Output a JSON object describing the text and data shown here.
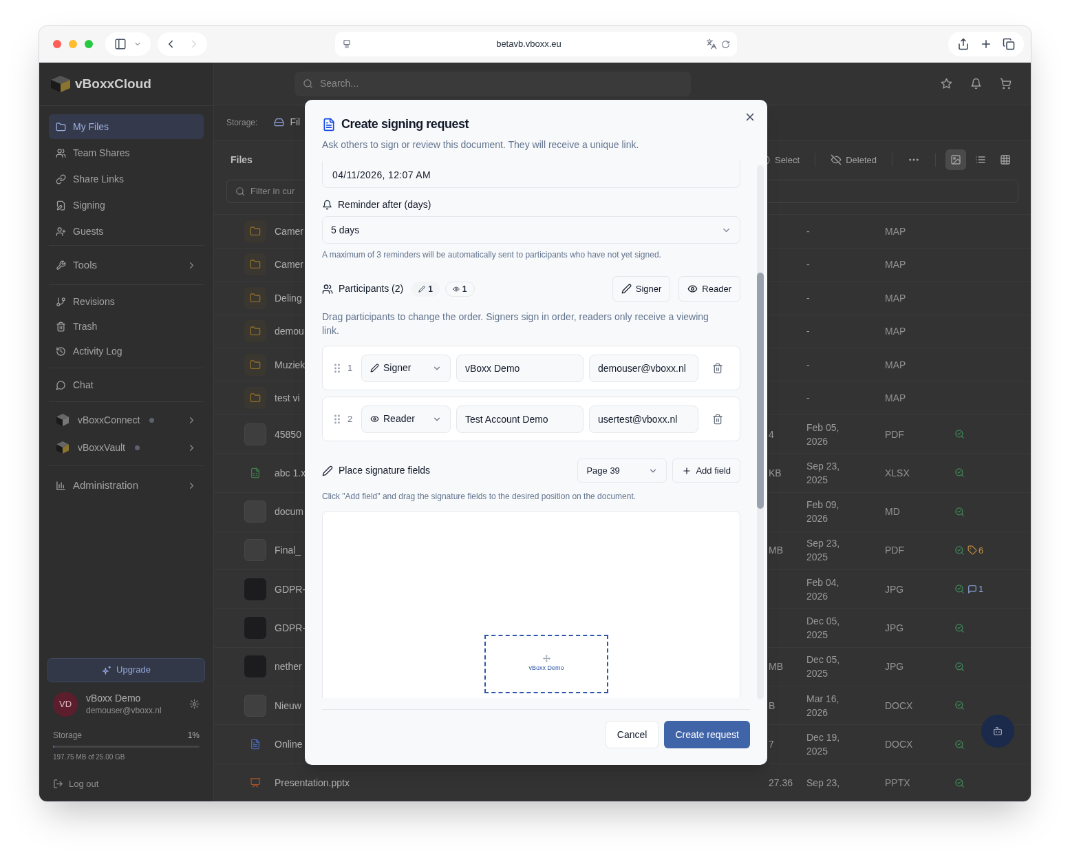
{
  "browser": {
    "url": "betavb.vboxx.eu"
  },
  "sidebar": {
    "logo": "vBoxxCloud",
    "groups": [
      [
        {
          "label": "My Files",
          "kind": "link",
          "selected": true
        },
        {
          "label": "Team Shares",
          "kind": "link",
          "selected": false
        },
        {
          "label": "Share Links",
          "kind": "link",
          "selected": false
        },
        {
          "label": "Signing",
          "kind": "link",
          "selected": false
        },
        {
          "label": "Guests",
          "kind": "link",
          "selected": false
        }
      ],
      [
        {
          "label": "Tools",
          "kind": "menu",
          "selected": false
        }
      ],
      [
        {
          "label": "Revisions",
          "kind": "link",
          "selected": false
        },
        {
          "label": "Trash",
          "kind": "link",
          "selected": false
        },
        {
          "label": "Activity Log",
          "kind": "link",
          "selected": false
        }
      ],
      [
        {
          "label": "Chat",
          "kind": "link",
          "selected": false
        }
      ],
      [
        {
          "label": "vBoxxConnect",
          "kind": "app",
          "selected": false
        },
        {
          "label": "vBoxxVault",
          "kind": "app",
          "selected": false
        }
      ],
      [
        {
          "label": "Administration",
          "kind": "menu",
          "selected": false
        }
      ]
    ],
    "upgrade": "Upgrade",
    "user": {
      "initials": "VD",
      "name": "vBoxx Demo",
      "email": "demouser@vboxx.nl"
    },
    "storage": {
      "label": "Storage",
      "percent": "1%",
      "level": 0.01,
      "detail": "197.75 MB of 25.00 GB"
    },
    "logout": "Log out"
  },
  "topbar": {
    "search_placeholder": "Search..."
  },
  "location": {
    "label": "Storage:",
    "value": "Fil"
  },
  "files": {
    "title": "Files",
    "select": "Select",
    "deleted": "Deleted",
    "views": [
      {
        "selected": true
      },
      {
        "selected": false
      },
      {
        "selected": false
      }
    ],
    "filter_placeholder": "Filter in cur",
    "rows": [
      {
        "kind": "folder",
        "name": "Camer",
        "date": "-",
        "type": "MAP"
      },
      {
        "kind": "folder",
        "name": "Camer",
        "date": "-",
        "type": "MAP"
      },
      {
        "kind": "folder",
        "name": "Deling",
        "date": "-",
        "type": "MAP"
      },
      {
        "kind": "folder",
        "name": "demou",
        "date": "-",
        "type": "MAP"
      },
      {
        "kind": "folder",
        "name": "Muziek",
        "date": "-",
        "type": "MAP"
      },
      {
        "kind": "folder",
        "name": "test vi",
        "date": "-",
        "type": "MAP"
      },
      {
        "kind": "thumb",
        "name": "45850",
        "size": "4",
        "date": "Feb 05, 2026",
        "type": "PDF",
        "verified": true
      },
      {
        "kind": "sheet",
        "name": "abc 1.x",
        "size": "KB",
        "date": "Sep 23, 2025",
        "type": "XLSX",
        "verified": true
      },
      {
        "kind": "blank",
        "name": "docum",
        "date": "Feb 09, 2026",
        "type": "MD",
        "verified": true
      },
      {
        "kind": "thumb",
        "name": "Final_",
        "size": "MB",
        "date": "Sep 23, 2025",
        "type": "PDF",
        "verified": true,
        "tags": "6"
      },
      {
        "kind": "photo",
        "name": "GDPR-",
        "date": "Feb 04, 2026",
        "type": "JPG",
        "verified": true,
        "comments": "1"
      },
      {
        "kind": "photo",
        "name": "GDPR-",
        "date": "Dec 05, 2025",
        "type": "JPG",
        "verified": true
      },
      {
        "kind": "photo",
        "name": "nether",
        "size": "MB",
        "date": "Dec 05, 2025",
        "type": "JPG",
        "verified": true
      },
      {
        "kind": "blank",
        "name": "Nieuw",
        "size": "B",
        "date": "Mar 16, 2026",
        "type": "DOCX",
        "verified": true
      },
      {
        "kind": "doc",
        "name": "Online",
        "size": "7",
        "date": "Dec 19, 2025",
        "type": "DOCX",
        "verified": true
      },
      {
        "kind": "slides",
        "name": "Presentation.pptx",
        "size": "27.36",
        "date": "Sep 23,",
        "type": "PPTX",
        "verified": true
      }
    ]
  },
  "modal": {
    "title": "Create signing request",
    "subtitle": "Ask others to sign or review this document. They will receive a unique link.",
    "deadline_value": "04/11/2026, 12:07 AM",
    "reminder": {
      "label": "Reminder after (days)",
      "value": "5 days",
      "hint": "A maximum of 3 reminders will be automatically sent to participants who have not yet signed."
    },
    "participants": {
      "label": "Participants (2)",
      "signer_count": "1",
      "reader_count": "1",
      "add_signer": "Signer",
      "add_reader": "Reader",
      "hint": "Drag participants to change the order. Signers sign in order, readers only receive a viewing link.",
      "list": [
        {
          "number": "1",
          "kind": "signer",
          "role": "Signer",
          "name": "vBoxx Demo",
          "email": "demouser@vboxx.nl"
        },
        {
          "number": "2",
          "kind": "reader",
          "role": "Reader",
          "name": "Test Account Demo",
          "email": "usertest@vboxx.nl"
        }
      ]
    },
    "signature_fields": {
      "label": "Place signature fields",
      "page": "Page 39",
      "add": "Add field",
      "hint": "Click \"Add field\" and drag the signature fields to the desired position on the document.",
      "fields": [
        {
          "label": "vBoxx Demo"
        }
      ]
    },
    "cancel": "Cancel",
    "submit": "Create request"
  }
}
